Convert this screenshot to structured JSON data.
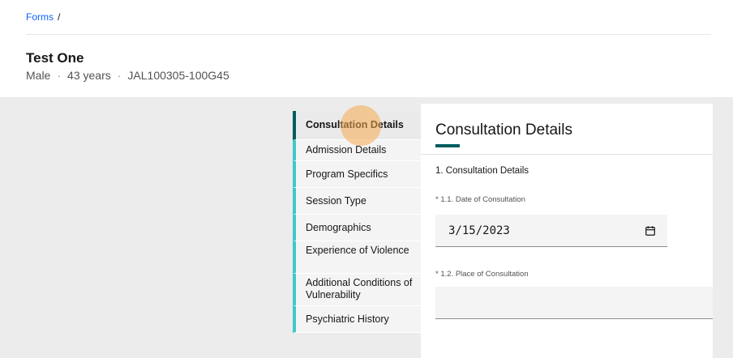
{
  "breadcrumb": {
    "forms": "Forms",
    "separator": "/"
  },
  "patient": {
    "name": "Test One",
    "sex": "Male",
    "age": "43 years",
    "id": "JAL100305-100G45",
    "separator": "·"
  },
  "steps": [
    {
      "label": "Consultation Details",
      "active": true
    },
    {
      "label": "Admission Details",
      "active": false
    },
    {
      "label": "Program Specifics",
      "active": false
    },
    {
      "label": "Session Type",
      "active": false
    },
    {
      "label": "Demographics",
      "active": false
    },
    {
      "label": "Experience of Violence",
      "active": false
    },
    {
      "label": "Additional Conditions of Vulnerability",
      "active": false
    },
    {
      "label": "Psychiatric History",
      "active": false
    }
  ],
  "form": {
    "title": "Consultation Details",
    "section_title": "1. Consultation Details",
    "date_label_required": "*",
    "date_label": "1.1. Date of Consultation",
    "date_value": "3/15/2023",
    "date_icon": "calendar-icon",
    "place_label_required": "*",
    "place_label": "1.2. Place of Consultation",
    "place_value": ""
  },
  "colors": {
    "accent": "#005d5d",
    "step_bar": "#3fc9c9",
    "link": "#0f62fe",
    "cursor_highlight": "#f6aa50"
  }
}
